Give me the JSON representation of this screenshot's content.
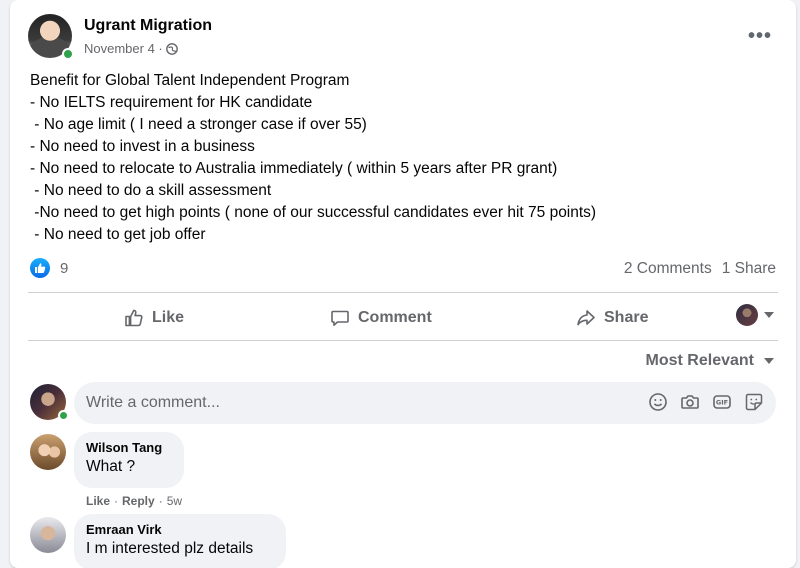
{
  "post": {
    "author": "Ugrant Migration",
    "date": "November 4 ·",
    "privacy_icon": "globe-icon",
    "more_label": "•••",
    "body": "Benefit for Global Talent Independent Program\n- No IELTS requirement for HK candidate\n - No age limit ( I need a stronger case if over 55)\n- No need to invest in a business\n- No need to relocate to Australia immediately ( within 5 years after PR grant)\n - No need to do a skill assessment\n -No need to get high points ( none of our successful candidates ever hit 75 points)\n - No need to get job offer"
  },
  "stats": {
    "likes": "9",
    "comments": "2 Comments",
    "shares": "1 Share"
  },
  "actions": {
    "like": "Like",
    "comment": "Comment",
    "share": "Share"
  },
  "sort_label": "Most Relevant",
  "composer": {
    "placeholder": "Write a comment..."
  },
  "comments": [
    {
      "name": "Wilson Tang",
      "text": "What ?",
      "like": "Like",
      "reply": "Reply",
      "age": "5w"
    },
    {
      "name": "Emraan Virk",
      "text": "I m interested plz details"
    }
  ],
  "colors": {
    "accent": "#1877f2",
    "secondary_text": "#65676b",
    "online": "#31a24c"
  }
}
